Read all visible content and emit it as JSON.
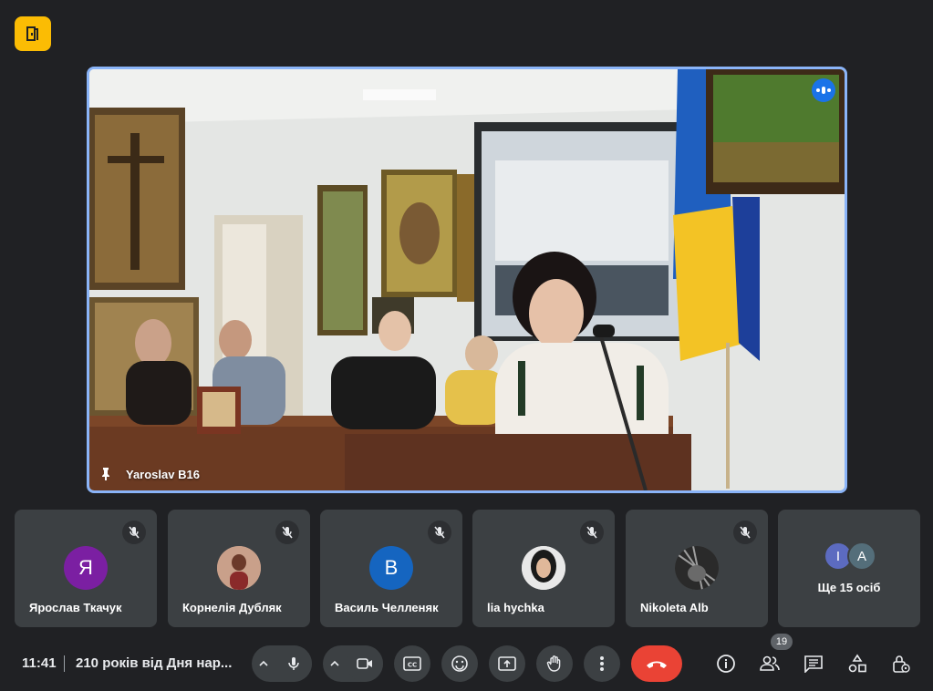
{
  "app": {
    "logo_icon": "meet-door-icon",
    "accent": "#fbbc04"
  },
  "main_video": {
    "participant_name": "Yaroslav B16",
    "pinned": true,
    "speaking": true,
    "border_color": "#8ab4f8"
  },
  "participants": [
    {
      "name": "Ярослав Ткачук",
      "initial": "Я",
      "avatar_color": "#7b1fa2",
      "muted": true,
      "photo": false
    },
    {
      "name": "Корнелія Дубляк",
      "initial": "",
      "avatar_color": "#b07a6a",
      "muted": true,
      "photo": true
    },
    {
      "name": "Василь Челленяк",
      "initial": "В",
      "avatar_color": "#1565c0",
      "muted": true,
      "photo": false
    },
    {
      "name": "lia hychka",
      "initial": "",
      "avatar_color": "#d9d9d9",
      "muted": true,
      "photo": true
    },
    {
      "name": "Nikoleta Alb",
      "initial": "",
      "avatar_color": "#555555",
      "muted": true,
      "photo": true
    }
  ],
  "more_tile": {
    "label": "Ще 15 осіб",
    "avatars": [
      {
        "initial": "I",
        "color": "#5c6bc0"
      },
      {
        "initial": "A",
        "color": "#546e7a"
      }
    ]
  },
  "bottom_bar": {
    "time": "11:41",
    "meeting_title": "210 років від Дня нар...",
    "participant_count": "19",
    "controls": {
      "mic": "mic-icon",
      "camera": "camera-icon",
      "captions": "captions-icon",
      "emoji": "emoji-icon",
      "present": "present-icon",
      "raise_hand": "raise-hand-icon",
      "more": "more-options-icon",
      "end_call": "end-call-icon",
      "info": "info-icon",
      "people": "people-icon",
      "chat": "chat-icon",
      "activities": "activities-icon",
      "host_controls": "host-controls-icon"
    },
    "end_call_color": "#ea4335"
  }
}
